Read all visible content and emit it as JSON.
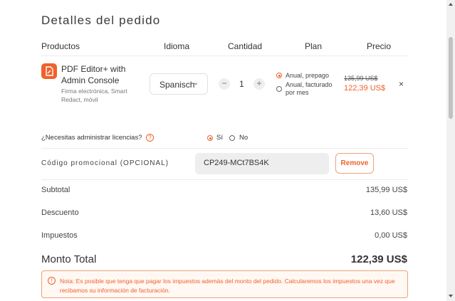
{
  "page_title": "Detalles del pedido",
  "table_headers": {
    "products": "Productos",
    "language": "Idioma",
    "quantity": "Cantidad",
    "plan": "Plan",
    "price": "Precio"
  },
  "product": {
    "name": "PDF Editor+ with Admin Console",
    "features": "Firma electrónica, Smart Redact, móvil",
    "language": "Spanisch",
    "quantity": "1",
    "quantity_minus": "−",
    "quantity_plus": "+",
    "plans": [
      {
        "label": "Anual, prepago",
        "selected": true
      },
      {
        "label": "Anual, facturado por mes",
        "selected": false
      }
    ],
    "price_original": "135,99 US$",
    "price_current": "122,39 US$",
    "remove_symbol": "×"
  },
  "licenses": {
    "question": "¿Necesitas administrar licencias?",
    "help_symbol": "?",
    "options": [
      {
        "label": "Sí",
        "selected": true
      },
      {
        "label": "No",
        "selected": false
      }
    ]
  },
  "promo": {
    "label": "Código promocional (OPCIONAL)",
    "code": "CP249-MCt7BS4K",
    "remove_label": "Remove"
  },
  "summary": {
    "subtotal_label": "Subtotal",
    "subtotal_value": "135,99 US$",
    "discount_label": "Descuento",
    "discount_value": "13,60 US$",
    "taxes_label": "Impuestos",
    "taxes_value": "0,00 US$",
    "total_label": "Monto Total",
    "total_value": "122,39 US$"
  },
  "note": {
    "icon_symbol": "!",
    "text": "Nota: Es posible que tenga que pagar los impuestos además del monto del pedido. Calcularemos los impuestos una vez que recibamos su información de facturación."
  },
  "colors": {
    "accent": "#f0612c",
    "note_border": "#f0a07a",
    "note_bg": "#fff8f3"
  }
}
